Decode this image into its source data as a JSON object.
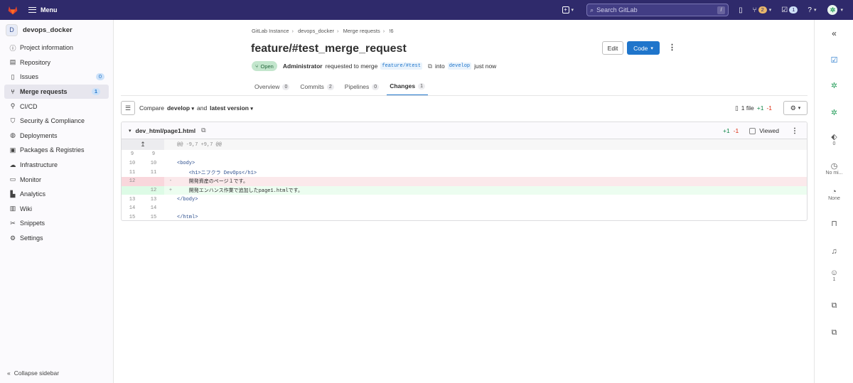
{
  "topbar": {
    "menu_label": "Menu",
    "search_placeholder": "Search GitLab",
    "search_shortcut": "/",
    "mr_count": "2",
    "todo_count": "1",
    "brand_color": "#2f2a6b"
  },
  "sidebar": {
    "project_initial": "D",
    "project_name": "devops_docker",
    "items": [
      {
        "label": "Project information",
        "icon": "info-icon"
      },
      {
        "label": "Repository",
        "icon": "repository-icon"
      },
      {
        "label": "Issues",
        "icon": "issues-icon",
        "badge": "0"
      },
      {
        "label": "Merge requests",
        "icon": "merge-request-icon",
        "badge": "1"
      },
      {
        "label": "CI/CD",
        "icon": "rocket-icon"
      },
      {
        "label": "Security & Compliance",
        "icon": "shield-icon"
      },
      {
        "label": "Deployments",
        "icon": "deployments-icon"
      },
      {
        "label": "Packages & Registries",
        "icon": "package-icon"
      },
      {
        "label": "Infrastructure",
        "icon": "cloud-icon"
      },
      {
        "label": "Monitor",
        "icon": "monitor-icon"
      },
      {
        "label": "Analytics",
        "icon": "chart-icon"
      },
      {
        "label": "Wiki",
        "icon": "book-icon"
      },
      {
        "label": "Snippets",
        "icon": "snippet-icon"
      },
      {
        "label": "Settings",
        "icon": "gear-icon"
      }
    ],
    "collapse_label": "Collapse sidebar"
  },
  "breadcrumb": [
    "GitLab Instance",
    "devops_docker",
    "Merge requests",
    "!6"
  ],
  "mr": {
    "title": "feature/#test_merge_request",
    "edit_label": "Edit",
    "code_label": "Code",
    "status": "Open",
    "author": "Administrator",
    "requested_text": "requested to merge",
    "source_branch": "feature/#test",
    "into_text": "into",
    "target_branch": "develop",
    "time": "just now"
  },
  "tabs": [
    {
      "label": "Overview",
      "count": "0"
    },
    {
      "label": "Commits",
      "count": "2"
    },
    {
      "label": "Pipelines",
      "count": "0"
    },
    {
      "label": "Changes",
      "count": "1",
      "active": true
    }
  ],
  "compare": {
    "compare_label": "Compare",
    "base": "develop",
    "and_label": "and",
    "version": "latest version",
    "files_label": "1 file",
    "additions": "+1",
    "deletions": "-1"
  },
  "diff": {
    "file_name": "dev_html/page1.html",
    "additions": "+1",
    "deletions": "-1",
    "viewed_label": "Viewed",
    "hunk_header": "@@ -9,7 +9,7 @@",
    "lines": [
      {
        "old": "9",
        "new": "9",
        "sign": "",
        "type": "ctx",
        "text": ""
      },
      {
        "old": "10",
        "new": "10",
        "sign": "",
        "type": "ctx",
        "text": "<body>"
      },
      {
        "old": "11",
        "new": "11",
        "sign": "",
        "type": "ctx",
        "text": "    <h1>ニフクラ DevOps</h1>"
      },
      {
        "old": "12",
        "new": "",
        "sign": "-",
        "type": "del",
        "text": "    開発資産のページ１です。"
      },
      {
        "old": "",
        "new": "12",
        "sign": "+",
        "type": "add",
        "text": "    開発エンハンス作業で追加したpage1.htmlです。"
      },
      {
        "old": "13",
        "new": "13",
        "sign": "",
        "type": "ctx",
        "text": "</body>"
      },
      {
        "old": "14",
        "new": "14",
        "sign": "",
        "type": "ctx",
        "text": ""
      },
      {
        "old": "15",
        "new": "15",
        "sign": "",
        "type": "ctx",
        "text": "</html>"
      }
    ]
  },
  "right_sidebar": {
    "labels_count": "0",
    "milestone": "No mi...",
    "time_tracking": "None",
    "participants_count": "1"
  }
}
